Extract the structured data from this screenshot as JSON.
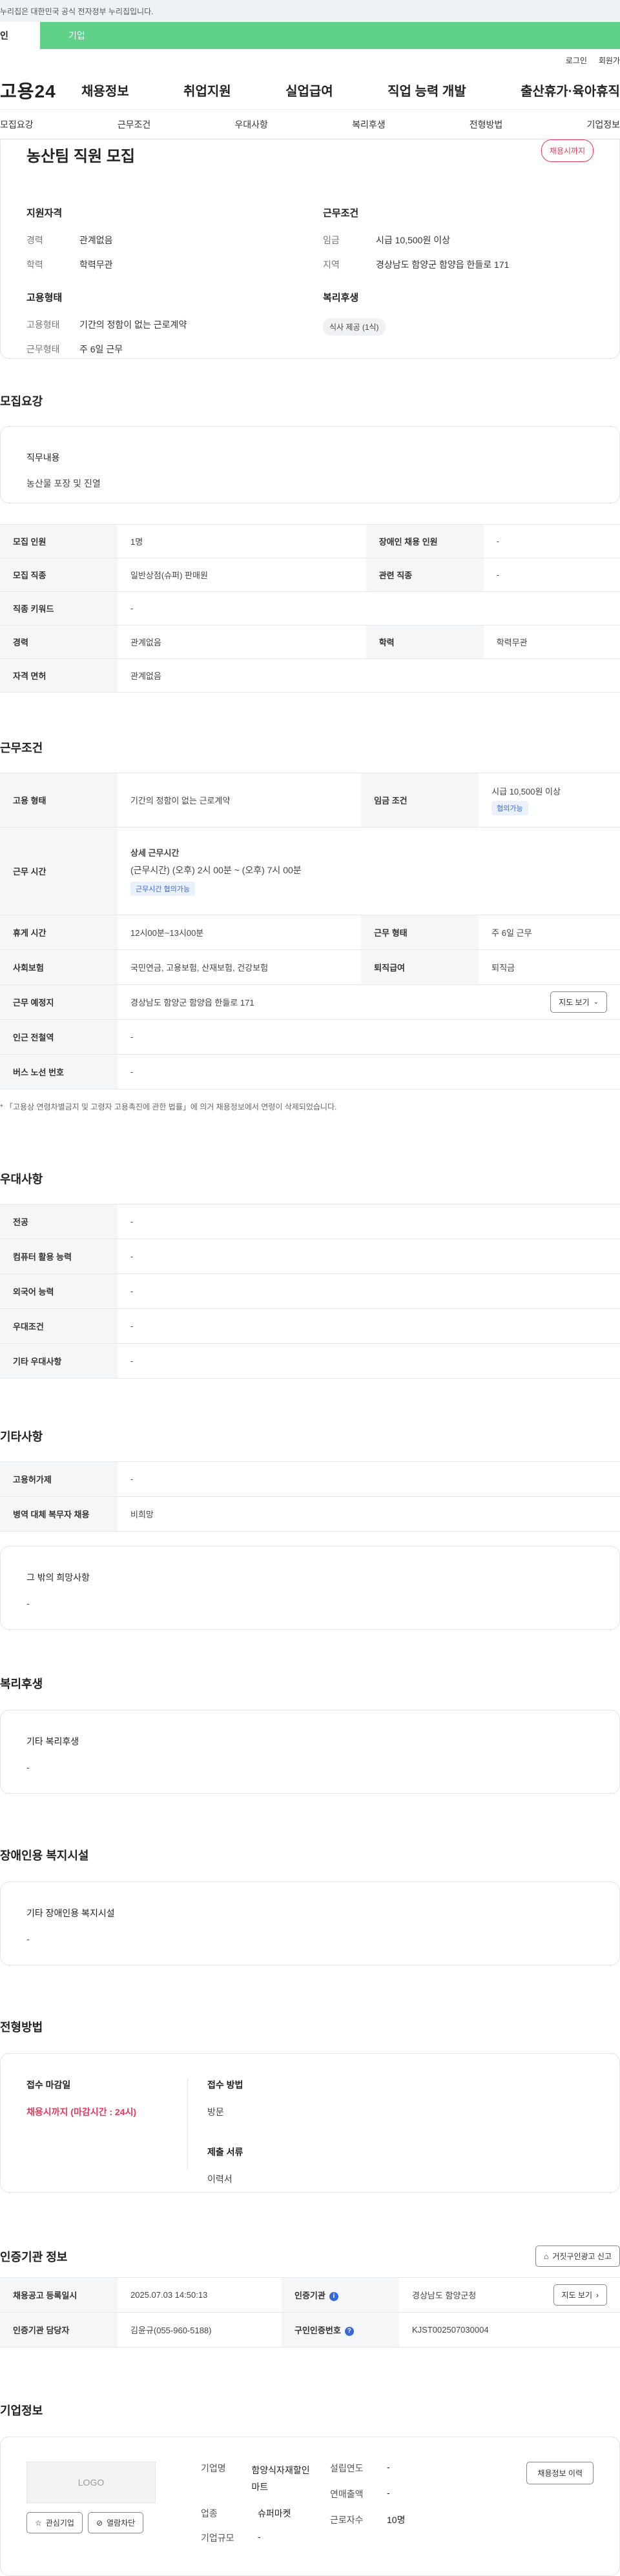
{
  "topbar": {
    "notice": "누리집은 대한민국 공식 전자정부 누리집입니다."
  },
  "tabs": {
    "a": "인",
    "b": "기업"
  },
  "util": {
    "login": "로그인",
    "join": "회원가"
  },
  "gnb": {
    "logo": "고용24",
    "items": [
      "채용정보",
      "취업지원",
      "실업급여",
      "직업 능력 개발",
      "출산휴가·육아휴직"
    ]
  },
  "subnav": [
    "모집요강",
    "근무조건",
    "우대사항",
    "복리후생",
    "전형방법",
    "기업정보"
  ],
  "summary": {
    "title": "농산팀 직원 모집",
    "badge": "채용시까지",
    "qual_title": "지원자격",
    "qual": [
      {
        "k": "경력",
        "v": "관계없음"
      },
      {
        "k": "학력",
        "v": "학력무관"
      }
    ],
    "cond_title": "근무조건",
    "cond": [
      {
        "k": "임금",
        "v": "시급 10,500원 이상"
      },
      {
        "k": "지역",
        "v": "경상남도 함양군 함양읍 한들로 171"
      }
    ],
    "emp_title": "고용형태",
    "emp": [
      {
        "k": "고용형태",
        "v": "기간의 정함이 없는 근로계약"
      },
      {
        "k": "근무형태",
        "v": "주 6일 근무"
      }
    ],
    "welfare_title": "복리후생",
    "welfare_chip": "식사 제공 (1식)"
  },
  "recruit": {
    "title": "모집요강",
    "duty_label": "직무내용",
    "duty_value": "농산물 포장 및 진열",
    "rows": [
      {
        "k1": "모집 인원",
        "v1": "1명",
        "k2": "장애인 채용 인원",
        "v2": "-"
      },
      {
        "k1": "모집 직종",
        "v1": "일반상점(슈퍼) 판매원",
        "k2": "관련 직종",
        "v2": "-"
      },
      {
        "k1": "직종 키워드",
        "v1": "-"
      },
      {
        "k1": "경력",
        "v1": "관계없음",
        "k2": "학력",
        "v2": "학력무관"
      },
      {
        "k1": "자격 면허",
        "v1": "관계없음"
      }
    ]
  },
  "work": {
    "title": "근무조건",
    "r1": {
      "k1": "고용 형태",
      "v1": "기간의 정함이 없는 근로계약",
      "k2": "임금 조건",
      "v2": "시급 10,500원 이상",
      "tag": "협의가능"
    },
    "r2": {
      "k": "근무 시간",
      "head": "상세 근무시간",
      "detail": "(근무시간) (오후) 2시 00분 ~ (오후) 7시 00분",
      "tag": "근무시간 협의가능"
    },
    "r3": {
      "k1": "휴게 시간",
      "v1": "12시00분~13시00분",
      "k2": "근무 형태",
      "v2": "주 6일 근무"
    },
    "r4": {
      "k1": "사회보험",
      "v1": "국민연금, 고용보험, 산재보험, 건강보험",
      "k2": "퇴직급여",
      "v2": "퇴직금"
    },
    "r5": {
      "k": "근무 예정지",
      "v": "경상남도 함양군 함양읍 한들로 171",
      "btn": "지도 보기"
    },
    "r6": {
      "k": "인근 전철역",
      "v": "-"
    },
    "r7": {
      "k": "버스 노선 번호",
      "v": "-"
    },
    "note": "* 「고용상 연령차별금지 및 고령자 고용촉진에 관한 법률」에 의거 채용정보에서 연령이 삭제되었습니다."
  },
  "pref": {
    "title": "우대사항",
    "rows": [
      {
        "k": "전공",
        "v": "-"
      },
      {
        "k": "컴퓨터 활용 능력",
        "v": "-"
      },
      {
        "k": "외국어 능력",
        "v": "-"
      },
      {
        "k": "우대조건",
        "v": "-"
      },
      {
        "k": "기타 우대사항",
        "v": "-"
      }
    ]
  },
  "etc": {
    "title": "기타사항",
    "rows": [
      {
        "k": "고용허가제",
        "v": "-"
      },
      {
        "k": "병역 대체 복무자 채용",
        "v": "비희망"
      }
    ],
    "box_label": "그 밖의 희망사항",
    "box_value": "-"
  },
  "welfare": {
    "title": "복리후생",
    "label": "기타 복리후생",
    "value": "-"
  },
  "disabled": {
    "title": "장애인용 복지시설",
    "label": "기타 장애인용 복지시설",
    "value": "-"
  },
  "selection": {
    "title": "전형방법",
    "deadline_label": "접수 마감일",
    "deadline_value": "채용시까지 (마감시간 : 24시)",
    "method_label": "접수 방법",
    "method_value": "방문",
    "docs_label": "제출 서류",
    "docs_value": "이력서"
  },
  "agency": {
    "title": "인증기관 정보",
    "report_btn": "거짓구인광고 신고",
    "r1": {
      "k1": "채용공고 등록일시",
      "v1": "2025.07.03 14:50:13",
      "k2": "인증기관",
      "v2": "경상남도 함양군청",
      "btn": "지도 보기"
    },
    "r2": {
      "k1": "인증기관 담당자",
      "v1": "김윤규(055-960-5188)",
      "k2": "구인인증번호",
      "v2": "KJST002507030004"
    }
  },
  "company": {
    "title": "기업정보",
    "logo_text": "LOGO",
    "fav_btn": "관심기업",
    "block_btn": "열람차단",
    "name_label": "기업명",
    "name_value": "함양식자재할인마트",
    "industry_label": "업종",
    "industry_value": "슈퍼마켓",
    "size_label": "기업규모",
    "size_value": "-",
    "founded_label": "설립연도",
    "founded_value": "-",
    "sales_label": "연매출액",
    "sales_value": "-",
    "employees_label": "근로자수",
    "employees_value": "10명",
    "history_btn": "채용정보 이력"
  }
}
